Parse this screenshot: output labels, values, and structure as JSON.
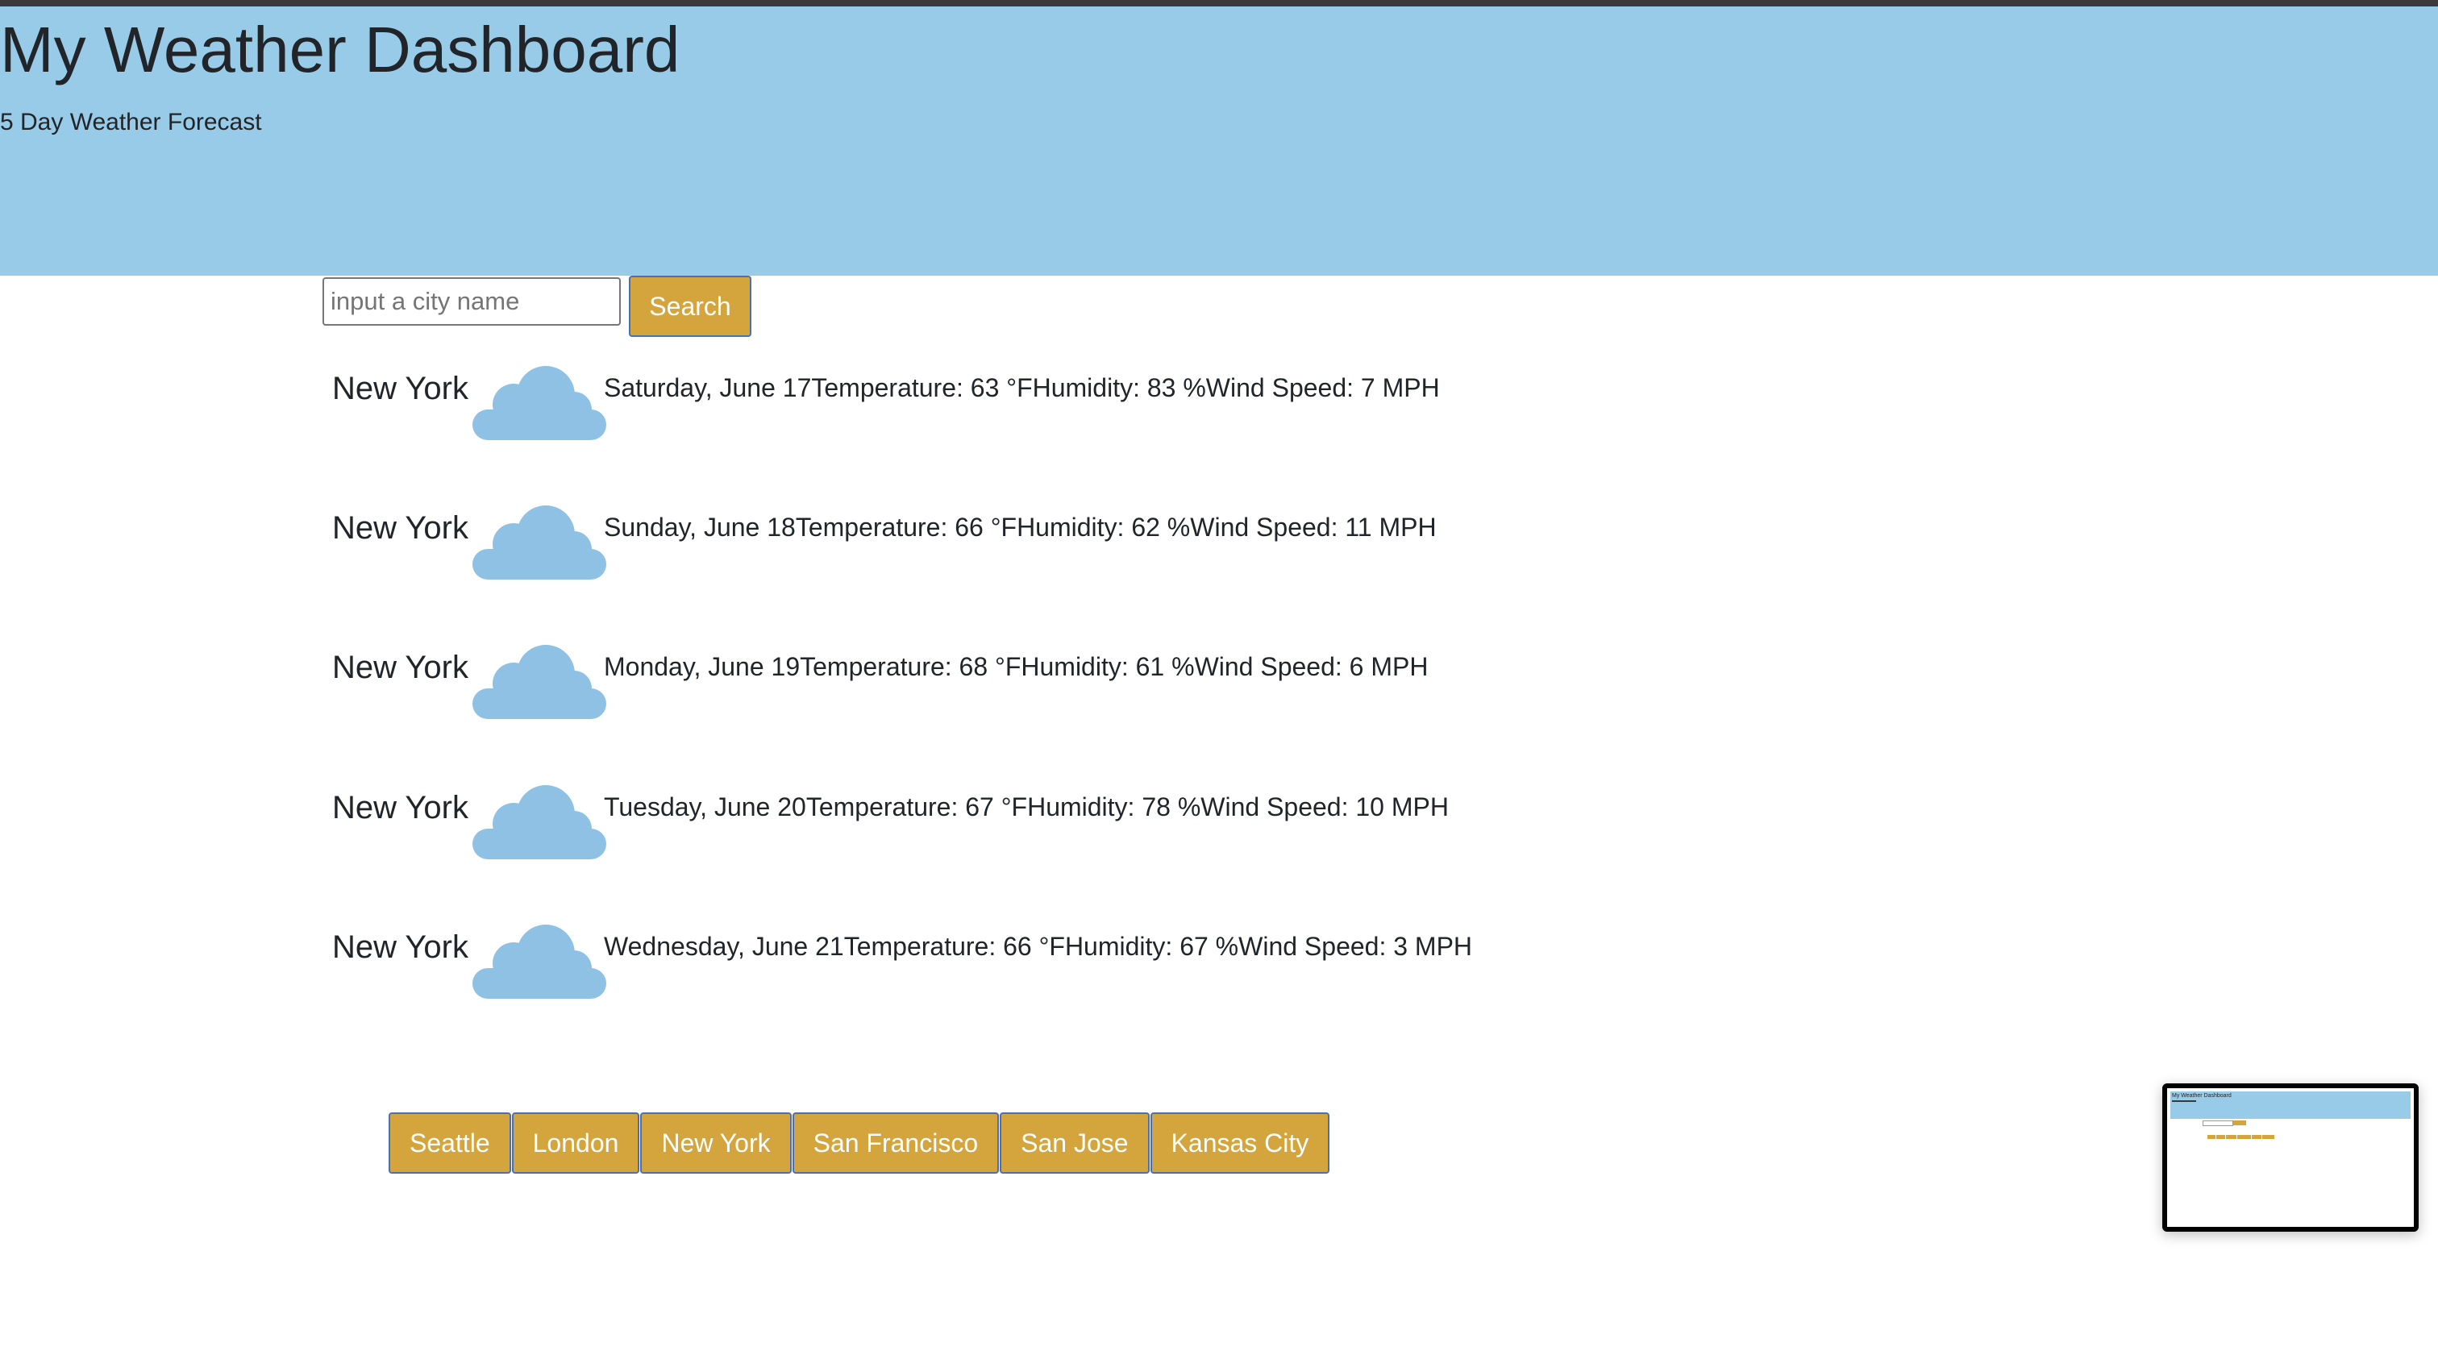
{
  "header": {
    "title": "My Weather Dashboard",
    "subtitle": "5 Day Weather Forecast"
  },
  "search": {
    "placeholder": "input a city name",
    "value": "",
    "button_label": "Search"
  },
  "forecast": [
    {
      "city": "New York",
      "icon": "cloud-icon",
      "details": "Saturday, June 17Temperature: 63 °FHumidity: 83 %Wind Speed: 7 MPH"
    },
    {
      "city": "New York",
      "icon": "cloud-icon",
      "details": "Sunday, June 18Temperature: 66 °FHumidity: 62 %Wind Speed: 11 MPH"
    },
    {
      "city": "New York",
      "icon": "cloud-icon",
      "details": "Monday, June 19Temperature: 68 °FHumidity: 61 %Wind Speed: 6 MPH"
    },
    {
      "city": "New York",
      "icon": "cloud-icon",
      "details": "Tuesday, June 20Temperature: 67 °FHumidity: 78 %Wind Speed: 10 MPH"
    },
    {
      "city": "New York",
      "icon": "cloud-icon",
      "details": "Wednesday, June 21Temperature: 66 °FHumidity: 67 %Wind Speed: 3 MPH"
    }
  ],
  "history": [
    "Seattle",
    "London",
    "New York",
    "San Francisco",
    "San Jose",
    "Kansas City"
  ],
  "thumbnail": {
    "title": "My Weather Dashboard"
  },
  "colors": {
    "hero_background": "#98cbe8",
    "button_background": "#d4a53c",
    "button_border": "#4a6fb5",
    "cloud": "#8ec1e3"
  }
}
